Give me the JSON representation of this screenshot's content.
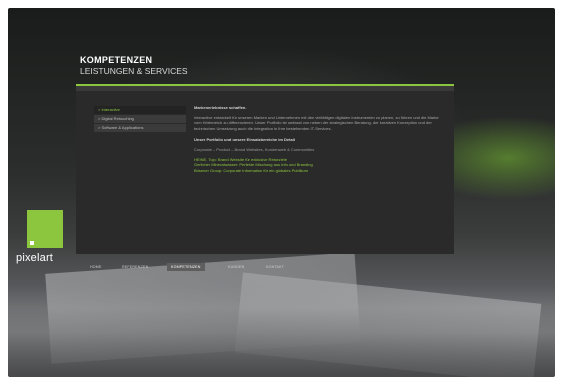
{
  "brand": {
    "logo_text": "pixelart",
    "accent": "#8cc63f"
  },
  "header": {
    "title": "KOMPETENZEN",
    "subtitle": "LEISTUNGEN & SERVICES"
  },
  "subnav": {
    "items": [
      {
        "label": "> Interactive",
        "active": true
      },
      {
        "label": "> Digital Retouching",
        "active": false
      },
      {
        "label": "> Software & Applications",
        "active": false
      }
    ]
  },
  "content": {
    "heading": "Markenerlebnisse schaffen.",
    "body": "Interactive entwickelt für unseren Marken und Unternehmen mit den vielfältigen digitalen Instrumenten zu planen, zu führen und die Marke vom Hörbereich zu differenzieren. Unser Portfolio ist umfasst von neben der strategischen Beratung, der kreativen Konzeption und der technischen Umsetzung auch die Integration in Ihre bestehenden IT-Services.",
    "portfolio_heading": "Unser Portfolio und unsere Einsatzbereiche im Detail",
    "portfolio_line": "Corporate – Product – Brand Websites, Kundenweb & Communities",
    "links": [
      "HEINE, Tojo: Brand Website für exklusive Reiseziele",
      "Gerlicher Mineralwasser: Perfekte Mischung aus Info und Branding",
      "Brisener Group: Corporate Information für ein globales Publikum"
    ]
  },
  "mainnav": {
    "items": [
      {
        "label": "HOME",
        "active": false
      },
      {
        "label": "REFERENZEN",
        "active": false
      },
      {
        "label": "KOMPETENZEN",
        "active": true
      },
      {
        "label": "KUNDEN",
        "active": false
      },
      {
        "label": "KONTAKT",
        "active": false
      }
    ]
  }
}
